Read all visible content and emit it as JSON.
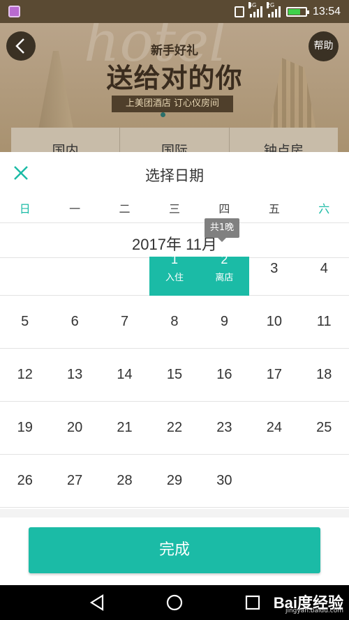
{
  "status_bar": {
    "time": "13:54",
    "network1": "4G",
    "network2": "2G",
    "battery_level": 0.7
  },
  "banner": {
    "line1": "新手好礼",
    "line2": "送给对的你",
    "line3": "上美团酒店 订心仪房间",
    "watermark": "hotel",
    "help_label": "帮助",
    "back_icon": "chevron-left-icon",
    "tabs": [
      "国内",
      "国际",
      "钟点房"
    ]
  },
  "modal": {
    "title": "选择日期",
    "close_icon": "close-icon",
    "weekdays": [
      "日",
      "一",
      "二",
      "三",
      "四",
      "五",
      "六"
    ],
    "month_label": "2017年 11月",
    "tooltip": "共1晚",
    "done_label": "完成",
    "accent_color": "#1bbba6"
  },
  "calendar": {
    "weeks": [
      [
        "",
        "",
        "",
        "1",
        "2",
        "3",
        "4"
      ],
      [
        "5",
        "6",
        "7",
        "8",
        "9",
        "10",
        "11"
      ],
      [
        "12",
        "13",
        "14",
        "15",
        "16",
        "17",
        "18"
      ],
      [
        "19",
        "20",
        "21",
        "22",
        "23",
        "24",
        "25"
      ],
      [
        "26",
        "27",
        "28",
        "29",
        "30",
        "",
        ""
      ]
    ],
    "checkin": {
      "day": "1",
      "label": "入住"
    },
    "checkout": {
      "day": "2",
      "label": "离店"
    }
  },
  "watermark": {
    "brand": "Bai度经验",
    "url": "jingyan.baidu.com"
  }
}
